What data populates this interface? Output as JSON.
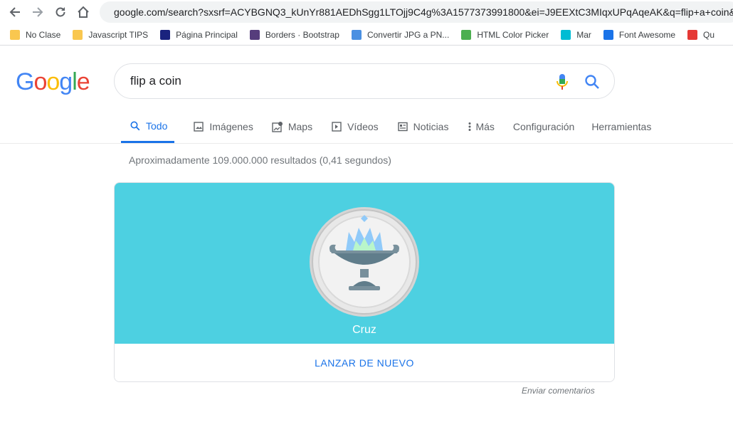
{
  "browser": {
    "url": "google.com/search?sxsrf=ACYBGNQ3_kUnYr881AEDhSgg1LTOjj9C4g%3A1577373991800&ei=J9EEXtC3MIqxUPqAqeAK&q=flip+a+coin&o",
    "bookmarks": [
      {
        "label": "No Clase",
        "icon": "folder-icon",
        "color": "#f9c74f"
      },
      {
        "label": "Javascript TIPS",
        "icon": "folder-icon",
        "color": "#f9c74f"
      },
      {
        "label": "Página Principal",
        "icon": "crest-icon",
        "color": "#1a237e"
      },
      {
        "label": "Borders · Bootstrap",
        "icon": "bootstrap-icon",
        "color": "#563d7c"
      },
      {
        "label": "Convertir JPG a PN...",
        "icon": "heart-icon",
        "color": "#4a90e2"
      },
      {
        "label": "HTML Color Picker",
        "icon": "w3-icon",
        "color": "#4caf50"
      },
      {
        "label": "Mar",
        "icon": "p-icon",
        "color": "#00bcd4"
      },
      {
        "label": "Font Awesome",
        "icon": "flag-icon",
        "color": "#1a73e8"
      },
      {
        "label": "Qu",
        "icon": "medal-icon",
        "color": "#e53935"
      }
    ]
  },
  "search": {
    "logo": [
      "G",
      "o",
      "o",
      "g",
      "l",
      "e"
    ],
    "logo_colors": [
      "#4285f4",
      "#ea4335",
      "#fbbc05",
      "#4285f4",
      "#34a853",
      "#ea4335"
    ],
    "query": "flip a coin"
  },
  "tabs": [
    {
      "label": "Todo",
      "icon": "search-icon",
      "active": true
    },
    {
      "label": "Imágenes",
      "icon": "image-icon"
    },
    {
      "label": "Maps",
      "icon": "map-icon"
    },
    {
      "label": "Vídeos",
      "icon": "video-icon"
    },
    {
      "label": "Noticias",
      "icon": "news-icon"
    },
    {
      "label": "Más",
      "icon": "more-icon"
    },
    {
      "label": "Configuración",
      "icon": ""
    },
    {
      "label": "Herramientas",
      "icon": ""
    }
  ],
  "results_stats": "Aproximadamente 109.000.000 resultados (0,41 segundos)",
  "coin_widget": {
    "result": "Cruz",
    "button": "LANZAR DE NUEVO",
    "feedback": "Enviar comentarios",
    "background": "#4dd0e1"
  }
}
